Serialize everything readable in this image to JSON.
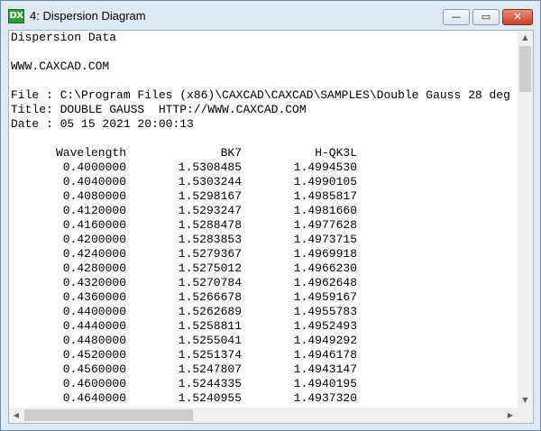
{
  "window": {
    "icon_label": "DX",
    "title": "4: Dispersion Diagram",
    "minimize_glyph": "—",
    "maximize_glyph": "▭",
    "close_glyph": "✕"
  },
  "header_lines": [
    "Dispersion Data",
    "",
    "WWW.CAXCAD.COM",
    "",
    "File : C:\\Program Files (x86)\\CAXCAD\\CAXCAD\\SAMPLES\\Double Gauss 28 deg",
    "Title: DOUBLE GAUSS  HTTP://WWW.CAXCAD.COM",
    "Date : 05 15 2021 20:00:13"
  ],
  "table": {
    "columns": [
      "Wavelength",
      "BK7",
      "H-QK3L"
    ],
    "rows": [
      [
        "0.4000000",
        "1.5308485",
        "1.4994530"
      ],
      [
        "0.4040000",
        "1.5303244",
        "1.4990105"
      ],
      [
        "0.4080000",
        "1.5298167",
        "1.4985817"
      ],
      [
        "0.4120000",
        "1.5293247",
        "1.4981660"
      ],
      [
        "0.4160000",
        "1.5288478",
        "1.4977628"
      ],
      [
        "0.4200000",
        "1.5283853",
        "1.4973715"
      ],
      [
        "0.4240000",
        "1.5279367",
        "1.4969918"
      ],
      [
        "0.4280000",
        "1.5275012",
        "1.4966230"
      ],
      [
        "0.4320000",
        "1.5270784",
        "1.4962648"
      ],
      [
        "0.4360000",
        "1.5266678",
        "1.4959167"
      ],
      [
        "0.4400000",
        "1.5262689",
        "1.4955783"
      ],
      [
        "0.4440000",
        "1.5258811",
        "1.4952493"
      ],
      [
        "0.4480000",
        "1.5255041",
        "1.4949292"
      ],
      [
        "0.4520000",
        "1.5251374",
        "1.4946178"
      ],
      [
        "0.4560000",
        "1.5247807",
        "1.4943147"
      ],
      [
        "0.4600000",
        "1.5244335",
        "1.4940195"
      ],
      [
        "0.4640000",
        "1.5240955",
        "1.4937320"
      ]
    ]
  },
  "scrollbars": {
    "up_glyph": "▲",
    "down_glyph": "▼",
    "left_glyph": "◀",
    "right_glyph": "▶"
  },
  "colors": {
    "titlebar": "#dfe9f3",
    "close_button": "#c8432b",
    "app_icon": "#2e9d3a"
  }
}
